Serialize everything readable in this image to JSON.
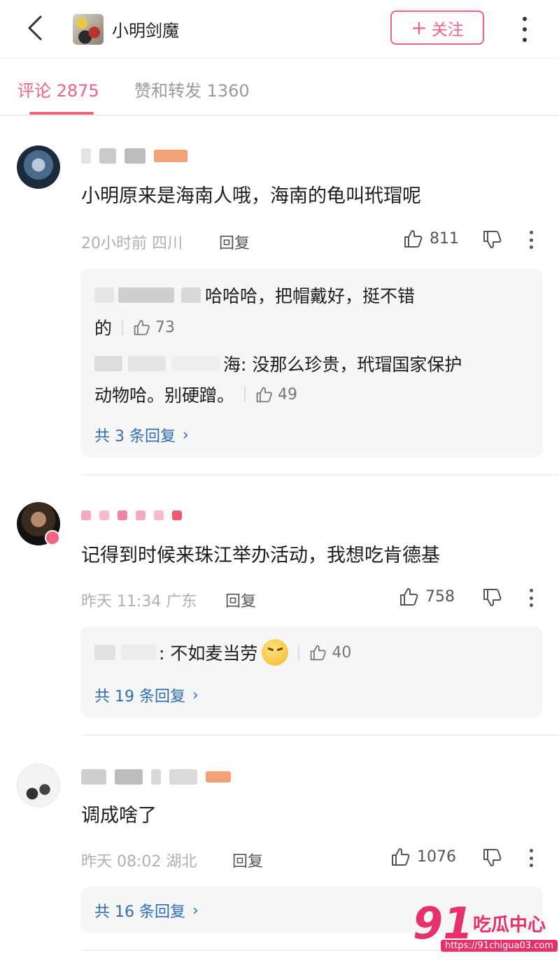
{
  "header": {
    "back_icon": "chevron-left-icon",
    "profile_name": "小明剑魔",
    "follow_label": "关注",
    "follow_plus": "+",
    "accent_color": "#f06482"
  },
  "tabs": [
    {
      "label": "评论 2875",
      "active": true
    },
    {
      "label": "赞和转发 1360",
      "active": false
    }
  ],
  "comments": [
    {
      "text": "小明原来是海南人哦，海南的龟叫玳瑁呢",
      "meta": "20小时前 四川",
      "reply_label": "回复",
      "likes": "811",
      "replies": [
        {
          "text_1": "哈哈哈，把帽戴好，挺不错",
          "text_2": "的",
          "likes": "73"
        },
        {
          "text_1": "海: 没那么珍贵，玳瑁国家保护",
          "text_2": "动物哈。别硬蹭。",
          "likes": "49"
        }
      ],
      "more_replies": "共 3 条回复"
    },
    {
      "text": "记得到时候来珠江举办活动，我想吃肯德基",
      "meta": "昨天 11:34 广东",
      "reply_label": "回复",
      "likes": "758",
      "replies": [
        {
          "text_1": ": 不如麦当劳",
          "likes": "40"
        }
      ],
      "more_replies": "共 19 条回复"
    },
    {
      "text": "调成啥了",
      "meta": "昨天 08:02 湖北",
      "reply_label": "回复",
      "likes": "1076",
      "more_replies": "共 16 条回复"
    }
  ],
  "watermark": {
    "brand_num": "91",
    "brand_text": "吃瓜中心",
    "url": "https://91chigua03.com"
  }
}
